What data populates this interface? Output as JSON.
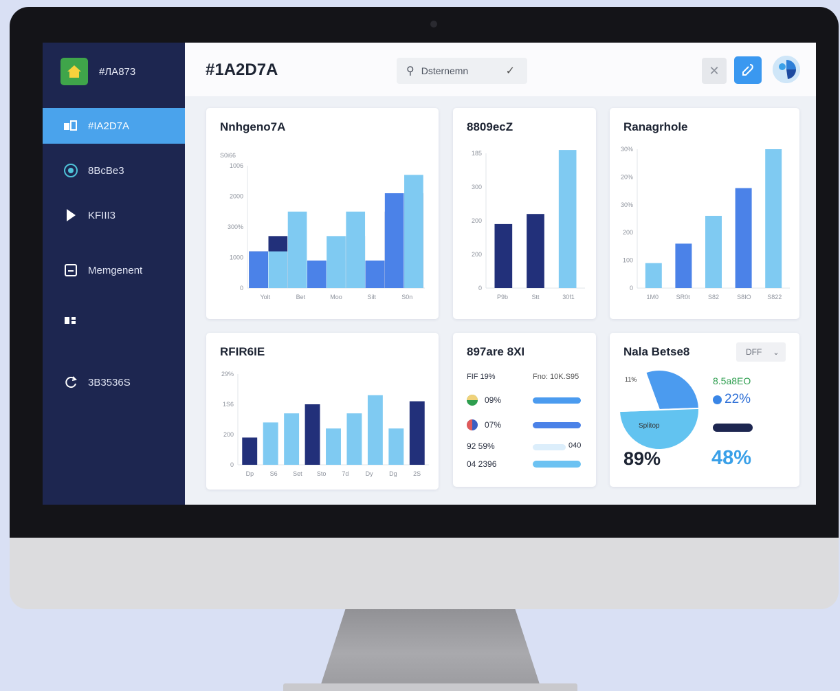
{
  "sidebar": {
    "brand": "#ЛA873",
    "items": [
      {
        "label": "#IA2D7A",
        "icon": "dashboard-icon",
        "active": true
      },
      {
        "label": "8BcBe3",
        "icon": "circle-badge-icon",
        "active": false
      },
      {
        "label": "KFIII3",
        "icon": "play-icon",
        "active": false
      },
      {
        "label": "Memgenent",
        "icon": "document-icon",
        "active": false
      },
      {
        "label": "",
        "icon": "grid-icon",
        "active": false
      },
      {
        "label": "3B3536S",
        "icon": "refresh-icon",
        "active": false
      }
    ]
  },
  "header": {
    "title": "#1A2D7A",
    "search_text": "Dsternemn",
    "close_icon": "close-icon",
    "edit_icon": "edit-icon",
    "avatar_icon": "avatar-icon"
  },
  "colors": {
    "sidebar": "#1d2650",
    "active": "#4aa3ec",
    "navy": "#22307a",
    "blue": "#4b82e8",
    "sky": "#7fcaf2",
    "pale": "#d7ebfb",
    "accent_text": "#3aa0e8",
    "green": "#2e9e4f"
  },
  "cards": {
    "c1": {
      "title": "Nnhgeno7A"
    },
    "c2": {
      "title": "8809ecZ"
    },
    "c3": {
      "title": "Ranagrhole"
    },
    "c4": {
      "title": "RFIR6IE"
    },
    "c5": {
      "title": "897are 8XI",
      "head_left": "FIF 19%",
      "head_right": "Fno: 10K.S95",
      "rows": [
        {
          "label": "09%",
          "icon": "green-dot-icon"
        },
        {
          "label": "07%",
          "icon": "flag-dot-icon"
        },
        {
          "label": "92 59%",
          "value": "040"
        },
        {
          "label": "04 2396"
        }
      ]
    },
    "c6": {
      "title": "Nala Betse8",
      "dropdown": "DFF",
      "pie_label_top": "11%",
      "pie_label_inner": "Splitop",
      "legend_title": "8.5a8EO",
      "legend_value": "22%",
      "big_left": "89%",
      "big_right": "48%"
    }
  },
  "chart_data": [
    {
      "type": "bar",
      "title": "Nnhgeno7A",
      "ylabel": "S0i66",
      "yticks": [
        "0",
        "1000",
        "300%",
        "2000",
        "1006"
      ],
      "categories": [
        "Yolt",
        "Bet",
        "Moo",
        "Silt",
        "S0n"
      ],
      "ylim": [
        0,
        4
      ],
      "series": [
        {
          "values": [
            1.2,
            1.7,
            1.9,
            0.9,
            0.9,
            1.7,
            0.9,
            2.5,
            3.1
          ]
        },
        {
          "values": [
            1.2,
            1.2,
            2.5,
            0.9,
            1.7,
            2.5,
            0.9,
            3.1,
            3.7
          ]
        }
      ]
    },
    {
      "type": "bar",
      "title": "8809ecZ",
      "yticks": [
        "0",
        "200",
        "200",
        "300",
        "185"
      ],
      "categories": [
        "P9b",
        "Stt",
        "30f1"
      ],
      "ylim": [
        0,
        4
      ],
      "values": [
        1.9,
        2.2,
        4.1
      ]
    },
    {
      "type": "bar",
      "title": "Ranagrhole",
      "yticks": [
        "0",
        "100",
        "200",
        "30%",
        "20%",
        "30%"
      ],
      "categories": [
        "1M0",
        "SR0t",
        "S82",
        "S8IO",
        "S822"
      ],
      "ylim": [
        0,
        5
      ],
      "values": [
        0.9,
        1.6,
        2.6,
        3.6,
        5.0
      ]
    },
    {
      "type": "bar",
      "title": "RFIR6IE",
      "yticks": [
        "0",
        "200",
        "1S6",
        "29%"
      ],
      "categories": [
        "Dp",
        "S6",
        "Set",
        "Sto",
        "7d",
        "Dy",
        "Dg",
        "2S"
      ],
      "ylim": [
        0,
        3
      ],
      "values": [
        0.9,
        1.4,
        1.7,
        2.0,
        1.2,
        1.7,
        2.3,
        1.2,
        2.1
      ]
    },
    {
      "type": "pie",
      "title": "Nala Betse8",
      "slices": [
        {
          "label": "11%",
          "value": 30
        },
        {
          "label": "Splitop",
          "value": 50
        },
        {
          "label": "",
          "value": 20
        }
      ]
    }
  ]
}
